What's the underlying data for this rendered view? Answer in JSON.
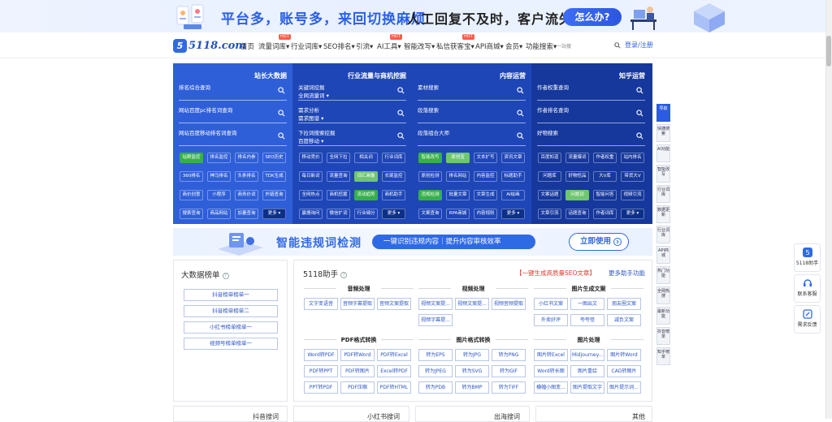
{
  "top_banner": {
    "headline": "平台多，账号多，来回切换麻烦",
    "sub": "人工回复不及时，客户流失",
    "cta": "怎么办?"
  },
  "logo": {
    "mark": "5",
    "text": "5118.com"
  },
  "nav": {
    "items": [
      "首页",
      "流量词库▾",
      "行业词库▾",
      "SEO排名▾",
      "引流▾",
      "AI工具▾",
      "智能改写▾",
      "私信获客宝▾",
      "API商城▾",
      "会员▾",
      "功能搜索▾"
    ],
    "extra": "一站搜",
    "hot": "HOT",
    "login": "登录/注册"
  },
  "panel": {
    "colors": {
      "col1": "#2f5fd8",
      "col2": "#1e46b7",
      "col3": "#1e46b7",
      "col4": "#16389c"
    },
    "cols": [
      {
        "title": "站长大数据",
        "rows": [
          {
            "label": "排名综合查询",
            "sub": ""
          },
          {
            "label": "网站百度pc排名词查询",
            "sub": ""
          },
          {
            "label": "网站百度移动排名词查询",
            "sub": ""
          }
        ],
        "tools": [
          "站群监控",
          "排名监控",
          "排名内参",
          "SEO历史",
          "360排名",
          "神马排名",
          "头条排名",
          "TDK生成",
          "商价创意",
          "小程序",
          "商务价词",
          "外链查询",
          "搜索查询",
          "商品网站",
          "加量查询",
          "更多 ▾"
        ]
      },
      {
        "title": "行业流量与商机挖掘",
        "rows": [
          {
            "label": "关键词挖掘",
            "sub": "全网流量词 ▾"
          },
          {
            "label": "需求分析",
            "sub": "需求图谱 ▾"
          },
          {
            "label": "下拉词搜索挖掘",
            "sub": "百度移动 ▾"
          }
        ],
        "tools": [
          "移动竞价",
          "全网下拉",
          "相关词",
          "行业词库",
          "每日新词",
          "流量查询",
          "词汇画像",
          "长尾监控",
          "全网热点",
          "商机挖掘",
          "流动趋势",
          "商机助手",
          "赢搜询问",
          "微信扩词",
          "行业细分",
          "更多 ▾"
        ]
      },
      {
        "title": "内容运营",
        "rows": [
          {
            "label": "素材搜索",
            "sub": ""
          },
          {
            "label": "段落搜索",
            "sub": ""
          },
          {
            "label": "段落组合大师",
            "sub": ""
          }
        ],
        "tools": [
          "智能改写",
          "原创宝",
          "文本扩写",
          "资讯文章",
          "原创检测",
          "排名网站",
          "内容监控",
          "标题助手",
          "违规检测",
          "批量文章",
          "文章生成",
          "AI绘画",
          "文案查询",
          "RPA商城",
          "内容规则",
          "更多 ▾"
        ]
      },
      {
        "title": "知乎运营",
        "rows": [
          {
            "label": "作者权重查询",
            "sub": ""
          },
          {
            "label": "作者排名查询",
            "sub": ""
          },
          {
            "label": "好物搜索",
            "sub": ""
          }
        ],
        "tools": [
          "百度知道",
          "流量爆词",
          "作者权重",
          "站内排名",
          "问题库",
          "好物挖品",
          "大V库",
          "带货大V",
          "文案话题",
          "问题词",
          "智能问答",
          "视频引流",
          "文章引流",
          "话题查询",
          "作者词库",
          "更多 ▾"
        ]
      }
    ]
  },
  "right_strip": [
    "导航",
    "快捷搜索",
    "AI功能",
    "智能改写",
    "行业词库",
    "数据更新",
    "行业词库",
    "API商城",
    "热门功能",
    "全网热搜",
    "最新功能",
    "抖音榜单",
    "知乎榜单"
  ],
  "float_bar": [
    {
      "label": "5118助手",
      "icon": "logo-icon"
    },
    {
      "label": "联系客服",
      "icon": "headset-icon"
    },
    {
      "label": "需求反馈",
      "icon": "feedback-icon"
    }
  ],
  "banner2": {
    "title": "智能违规词检测",
    "pill": "一键识别违规内容｜提升内容审核效率",
    "cta": "立即使用"
  },
  "bigdata": {
    "title": "大数据榜单",
    "buttons": [
      "抖音榜单榜单一",
      "抖音榜单榜单二",
      "小红书榜单榜单一",
      "视频号榜单榜单一"
    ]
  },
  "helper": {
    "title": "5118助手",
    "promo": "【一键生成高质量SEO文章】",
    "more": "更多助手功能",
    "sections": [
      {
        "title": "音频处理",
        "items": [
          "文字变语音",
          "音频字幕提取",
          "音频文案提取"
        ]
      },
      {
        "title": "视频处理",
        "items": [
          "视频文案提...",
          "视频文案提...",
          "视频音频提取",
          "视频字幕提..."
        ]
      },
      {
        "title": "图片生成文案",
        "items": [
          "小红书文案",
          "一图出文",
          "朋友圈文案",
          "外卖好评",
          "夸夸怪",
          "减负文案"
        ]
      },
      {
        "title": "PDF格式转换",
        "items": [
          "Word转PDF",
          "PDF转Word",
          "PDF转Excel",
          "PDF转PPT",
          "PDF转图片",
          "Excel转PDF",
          "PPT转PDF",
          "PDF压缩",
          "PDF转HTML"
        ]
      },
      {
        "title": "图片格式转换",
        "items": [
          "转为EPS",
          "转为JPG",
          "转为PNG",
          "转为JPEG",
          "转为SVG",
          "转为GIF",
          "转为PDB",
          "转为BMP",
          "转为TIFF"
        ]
      },
      {
        "title": "图片处理",
        "items": [
          "图片转Excel",
          "Midjourney...",
          "图片转Word",
          "Word转长图",
          "图片重绘",
          "CAD转图片",
          "横幅小图变...",
          "图片提取文字",
          "图片提示词..."
        ]
      }
    ]
  },
  "bottom": [
    "抖音搜词",
    "小红书搜词",
    "出海搜词",
    "其他"
  ]
}
